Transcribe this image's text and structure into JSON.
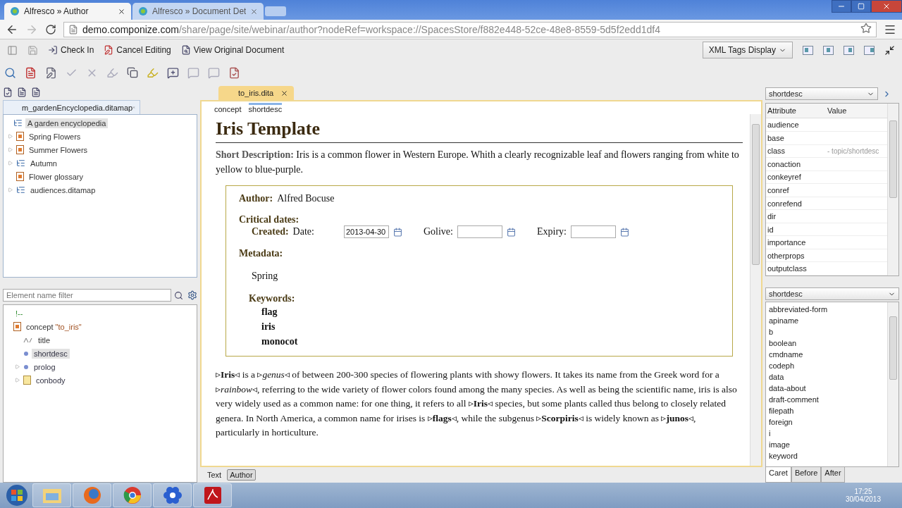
{
  "browser": {
    "tabs": [
      {
        "title": "Alfresco » Author",
        "selected": true
      },
      {
        "title": "Alfresco » Document Det",
        "selected": false
      }
    ],
    "url_host": "demo.componize.com",
    "url_path": "/share/page/site/webinar/author?nodeRef=workspace://SpacesStore/f882e448-52ce-48e8-8559-5d5f2edd1df4"
  },
  "toolbar": {
    "actions": [
      {
        "label": "Check In",
        "kind": "checkin"
      },
      {
        "label": "Cancel Editing",
        "kind": "cancel"
      },
      {
        "label": "View Original Document",
        "kind": "view"
      }
    ],
    "xml_tags_display": "XML Tags Display"
  },
  "map_panel": {
    "tab": "m_gardenEncyclopedia.ditamap",
    "tree": [
      {
        "label": "A garden encyclopedia",
        "kind": "map",
        "selected": true,
        "expanded": true,
        "children": [
          {
            "label": "Spring Flowers",
            "kind": "topic",
            "selected": false,
            "expanded": false
          },
          {
            "label": "Summer Flowers",
            "kind": "topic",
            "selected": false,
            "expanded": false
          },
          {
            "label": "Autumn",
            "kind": "map",
            "selected": false,
            "expanded": false
          },
          {
            "label": "Flower glossary",
            "kind": "topic",
            "selected": false
          },
          {
            "label": "audiences.ditamap",
            "kind": "map",
            "selected": false,
            "expanded": false
          }
        ]
      }
    ]
  },
  "outline": {
    "filter_placeholder": "Element name filter",
    "tree": [
      {
        "label": "!--",
        "kind": "comment",
        "selected": false
      },
      {
        "label": "concept",
        "attr": "\"to_iris\"",
        "kind": "topic",
        "selected": false,
        "expanded": true,
        "children": [
          {
            "label": "title",
            "kind": "text",
            "selected": false
          },
          {
            "label": "shortdesc",
            "kind": "element",
            "selected": true
          },
          {
            "label": "prolog",
            "kind": "element",
            "selected": false,
            "expanded": false
          },
          {
            "label": "conbody",
            "kind": "folder",
            "selected": false,
            "expanded": false
          }
        ]
      }
    ]
  },
  "editor": {
    "file_tab": "to_iris.dita",
    "breadcrumb": [
      {
        "label": "concept",
        "selected": false
      },
      {
        "label": "shortdesc",
        "selected": true
      }
    ],
    "title": "Iris Template",
    "short_description": "**Short Description:** Iris is a common flower in Western Europe. Whith a clearly recognizable leaf and flowers ranging from white to yellow to blue-purple.",
    "prolog": {
      "author_label": "Author:",
      "author": "Alfred Bocuse",
      "dates_label": "Critical dates:",
      "created_label": "Created:",
      "date_label": "Date:",
      "created": "2013-04-30",
      "golive_label": "Golive:",
      "expiry_label": "Expiry:",
      "metadata_label": "Metadata:",
      "audience": "Spring",
      "keywords_label": "Keywords:",
      "keywords": [
        "flag",
        "iris",
        "monocot"
      ]
    },
    "body": "▹**Iris**◃ is a ▹*genus*◃ of between 200-300 species of flowering plants with showy flowers. It takes its name from the Greek word for a ▹*rainbow*◃, referring to the wide variety of flower colors found among the many species. As well as being the scientific name, iris is also very widely used as a common name: for one thing, it refers to all ▹**Iris**◃ species, but some plants called thus belong to closely related genera. In North America, a common name for irises is ▹**flags**◃, while the subgenus ▹**Scorpiris**◃ is widely known as ▹**junos**◃, particularly in horticulture.",
    "view_tabs": [
      {
        "label": "Text",
        "selected": false
      },
      {
        "label": "Author",
        "selected": true
      }
    ]
  },
  "attributes": {
    "element": "shortdesc",
    "columns": [
      "Attribute",
      "Value"
    ],
    "rows": [
      {
        "name": "audience"
      },
      {
        "name": "base"
      },
      {
        "name": "class",
        "value": "- topic/shortdesc"
      },
      {
        "name": "conaction"
      },
      {
        "name": "conkeyref"
      },
      {
        "name": "conref"
      },
      {
        "name": "conrefend"
      },
      {
        "name": "dir"
      },
      {
        "name": "id"
      },
      {
        "name": "importance"
      },
      {
        "name": "otherprops"
      },
      {
        "name": "outputclass"
      }
    ]
  },
  "elements": {
    "element": "shortdesc",
    "items": [
      "abbreviated-form",
      "apiname",
      "b",
      "boolean",
      "cmdname",
      "codeph",
      "data",
      "data-about",
      "draft-comment",
      "filepath",
      "foreign",
      "i",
      "image",
      "keyword"
    ],
    "tabs": [
      {
        "label": "Caret",
        "selected": true
      },
      {
        "label": "Before",
        "selected": false
      },
      {
        "label": "After",
        "selected": false
      }
    ]
  },
  "taskbar": {
    "apps": [
      {
        "kind": "folder"
      },
      {
        "kind": "firefox"
      },
      {
        "kind": "chrome"
      },
      {
        "kind": "flower"
      },
      {
        "kind": "pdf"
      }
    ],
    "time": "17:25",
    "date": "30/04/2013"
  }
}
